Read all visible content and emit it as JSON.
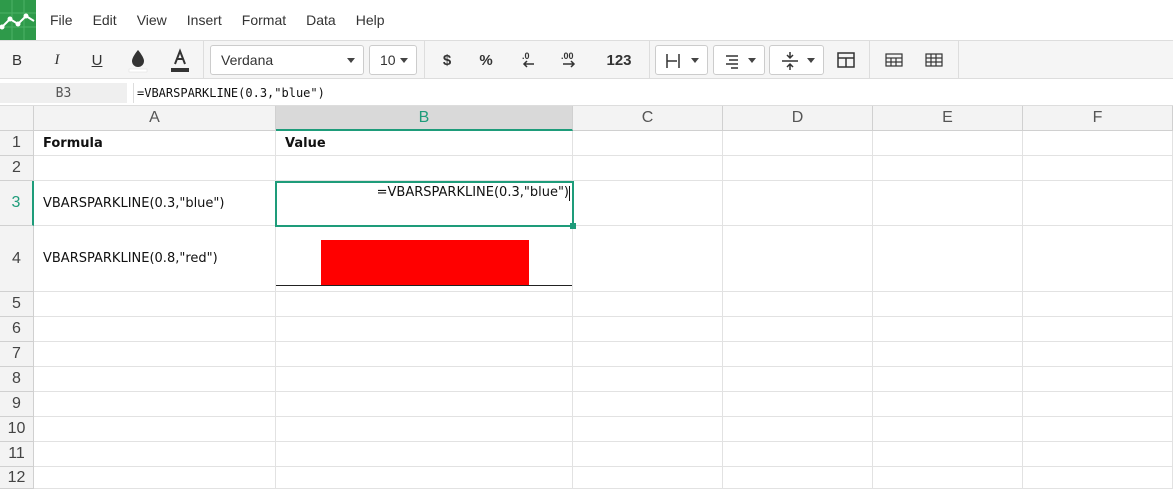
{
  "menu": {
    "items": [
      "File",
      "Edit",
      "View",
      "Insert",
      "Format",
      "Data",
      "Help"
    ]
  },
  "toolbar": {
    "bold": "B",
    "italic": "I",
    "underline": "U",
    "font": "Verdana",
    "font_size": "10",
    "currency": "$",
    "percent": "%",
    "decrease_decimals": ".0",
    "increase_decimals": ".00",
    "number_format": "123"
  },
  "formula_bar": {
    "cell_ref": "B3",
    "formula": "=VBARSPARKLINE(0.3,\"blue\")"
  },
  "sheet": {
    "columns": [
      "A",
      "B",
      "C",
      "D",
      "E",
      "F"
    ],
    "active_column": "B",
    "rows": [
      "1",
      "2",
      "3",
      "4",
      "5",
      "6",
      "7",
      "8",
      "9",
      "10",
      "11",
      "12"
    ],
    "active_row": "3",
    "cells": {
      "A1": "Formula",
      "B1": "Value",
      "A3": "VBARSPARKLINE(0.3,\"blue\")",
      "A4": "VBARSPARKLINE(0.8,\"red\")"
    },
    "editing_cell": "B3",
    "editing_text": "=VBARSPARKLINE(0.3,\"blue\")",
    "sparkline_B4": {
      "value": 0.8,
      "color": "#ff0000"
    }
  },
  "colors": {
    "accent": "#1e9c7a",
    "logo_bg": "#2e9a4a"
  }
}
